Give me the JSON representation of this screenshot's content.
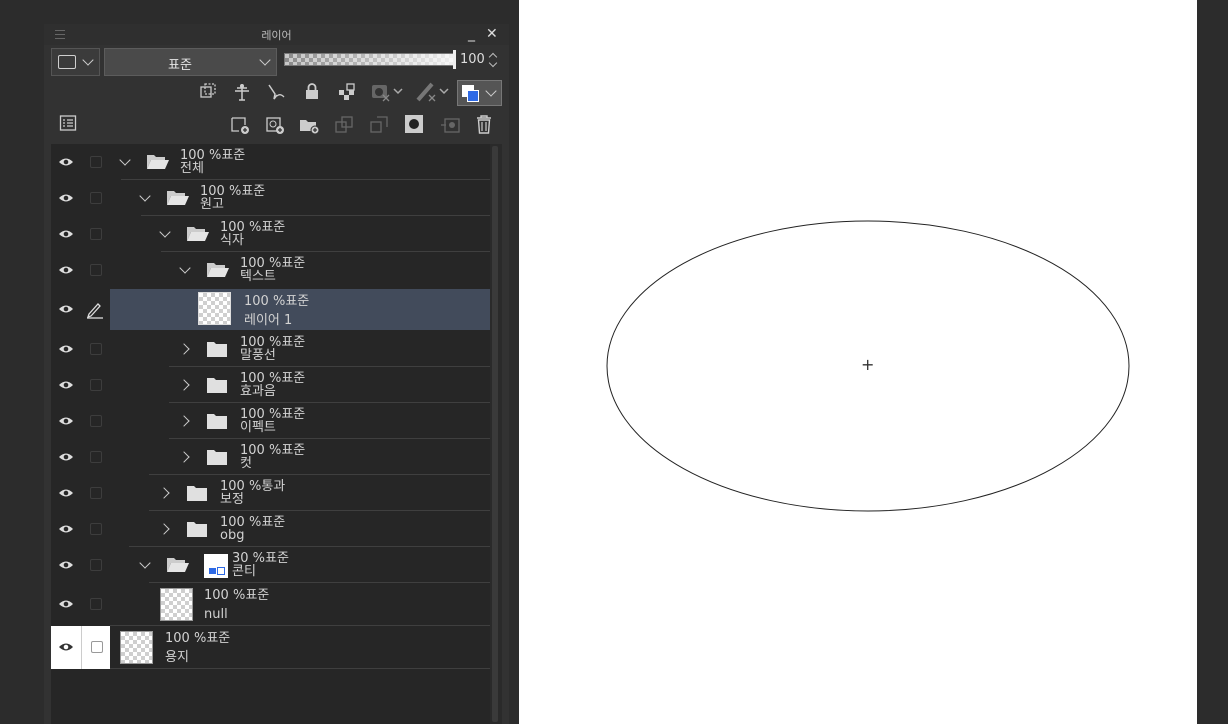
{
  "panel": {
    "title": "레이어",
    "minimize": "_",
    "close": "✕"
  },
  "toolbar": {
    "blend_mode": "표준",
    "opacity": "100"
  },
  "layers": [
    {
      "opacity": "100 %",
      "mode": "표준",
      "name": "전체",
      "type": "folder",
      "expanded": true
    },
    {
      "opacity": "100 %",
      "mode": "표준",
      "name": "원고",
      "type": "folder",
      "expanded": true
    },
    {
      "opacity": "100 %",
      "mode": "표준",
      "name": "식자",
      "type": "folder",
      "expanded": true
    },
    {
      "opacity": "100 %",
      "mode": "표준",
      "name": "텍스트",
      "type": "folder",
      "expanded": true
    },
    {
      "opacity": "100 %",
      "mode": "표준",
      "name": "레이어 1",
      "type": "raster",
      "selected": true
    },
    {
      "opacity": "100 %",
      "mode": "표준",
      "name": "말풍선",
      "type": "folder",
      "expanded": false
    },
    {
      "opacity": "100 %",
      "mode": "표준",
      "name": "효과음",
      "type": "folder",
      "expanded": false
    },
    {
      "opacity": "100 %",
      "mode": "표준",
      "name": "이펙트",
      "type": "folder",
      "expanded": false
    },
    {
      "opacity": "100 %",
      "mode": "표준",
      "name": "컷",
      "type": "folder",
      "expanded": false
    },
    {
      "opacity": "100 %",
      "mode": "통과",
      "name": "보정",
      "type": "folder",
      "expanded": false
    },
    {
      "opacity": "100 %",
      "mode": "표준",
      "name": "obg",
      "type": "folder",
      "expanded": false
    },
    {
      "opacity": "30 %",
      "mode": "표준",
      "name": "콘티",
      "type": "folder",
      "expanded": true
    },
    {
      "opacity": "100 %",
      "mode": "표준",
      "name": "null",
      "type": "raster"
    },
    {
      "opacity": "100 %",
      "mode": "표준",
      "name": "용지",
      "type": "paper"
    }
  ],
  "canvas": {
    "background": "#ffffff",
    "shape": "ellipse",
    "center_mark": "+"
  },
  "colors": {
    "panel_bg": "#323232",
    "list_bg": "#262626",
    "selected": "#424b5b",
    "accent": "#2e6ae6"
  }
}
